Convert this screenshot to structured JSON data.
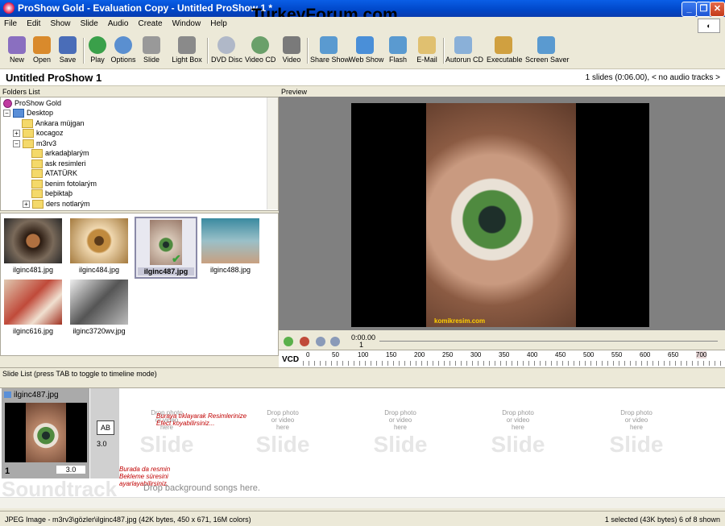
{
  "window": {
    "title": "ProShow Gold - Evaluation Copy - Untitled ProShow 1 *",
    "watermark": "TurkeyForum.com",
    "minimize_glyph": "_",
    "maximize_glyph": "❐",
    "close_glyph": "✕"
  },
  "menu": [
    "File",
    "Edit",
    "Show",
    "Slide",
    "Audio",
    "Create",
    "Window",
    "Help"
  ],
  "toolbar": [
    {
      "label": "New",
      "icon": "new-icon",
      "color": "#8a6fc0"
    },
    {
      "label": "Open",
      "icon": "open-icon",
      "color": "#d98a2c"
    },
    {
      "label": "Save",
      "icon": "save-icon",
      "color": "#4a6db8"
    },
    {
      "label": "Play",
      "icon": "play-icon",
      "color": "#3aa04a"
    },
    {
      "label": "Options",
      "icon": "options-icon",
      "color": "#5a8fd0"
    },
    {
      "label": "Slide",
      "icon": "slide-icon",
      "color": "#999"
    },
    {
      "label": "Light Box",
      "icon": "lightbox-icon",
      "color": "#8a8a8a"
    },
    {
      "label": "DVD Disc",
      "icon": "dvd-icon",
      "color": "#b0b8c8"
    },
    {
      "label": "Video CD",
      "icon": "vcd-icon",
      "color": "#6aa06a"
    },
    {
      "label": "Video",
      "icon": "video-icon",
      "color": "#7a7a7a"
    },
    {
      "label": "Share Show",
      "icon": "share-icon",
      "color": "#5a9ad0"
    },
    {
      "label": "Web Show",
      "icon": "web-icon",
      "color": "#4a8fd8"
    },
    {
      "label": "Flash",
      "icon": "flash-icon",
      "color": "#5a9ad0"
    },
    {
      "label": "E-Mail",
      "icon": "email-icon",
      "color": "#e0c070"
    },
    {
      "label": "Autorun CD",
      "icon": "autorun-icon",
      "color": "#8ab0d8"
    },
    {
      "label": "Executable",
      "icon": "executable-icon",
      "color": "#d0a040"
    },
    {
      "label": "Screen Saver",
      "icon": "screensaver-icon",
      "color": "#5a9ad0"
    }
  ],
  "project": {
    "name": "Untitled ProShow 1",
    "info": "1 slides (0:06.00), < no audio tracks >"
  },
  "folders": {
    "header": "Folders List",
    "items": [
      {
        "label": "ProShow Gold",
        "level": 0,
        "expander": "",
        "type": "app"
      },
      {
        "label": "Desktop",
        "level": 0,
        "expander": "−",
        "type": "desktop"
      },
      {
        "label": "Ankara müjgan",
        "level": 1,
        "expander": "",
        "type": "folder"
      },
      {
        "label": "kocagoz",
        "level": 1,
        "expander": "+",
        "type": "folder"
      },
      {
        "label": "m3rv3",
        "level": 1,
        "expander": "−",
        "type": "folder"
      },
      {
        "label": "arkadaþlarým",
        "level": 2,
        "expander": "",
        "type": "folder"
      },
      {
        "label": "ask resimleri",
        "level": 2,
        "expander": "",
        "type": "folder"
      },
      {
        "label": "ATATÜRK",
        "level": 2,
        "expander": "",
        "type": "folder"
      },
      {
        "label": "benim fotolarým",
        "level": 2,
        "expander": "",
        "type": "folder"
      },
      {
        "label": "beþiktaþ",
        "level": 2,
        "expander": "",
        "type": "folder"
      },
      {
        "label": "ders notlarým",
        "level": 2,
        "expander": "+",
        "type": "folder"
      }
    ]
  },
  "files": [
    {
      "name": "ilginc481.jpg",
      "color": "#5a4a3a"
    },
    {
      "name": "ilginc484.jpg",
      "color": "#a47a3e"
    },
    {
      "name": "ilginc487.jpg",
      "color": "#8a9a8a",
      "selected": true
    },
    {
      "name": "ilginc488.jpg",
      "color": "#4a8a9a"
    },
    {
      "name": "ilginc616.jpg",
      "color": "#c04a3a"
    },
    {
      "name": "ilginc3720wv.jpg",
      "color": "#6a6a6a"
    }
  ],
  "preview": {
    "header": "Preview",
    "caption": "komikresim.com",
    "time": "0:00.00",
    "slide_number": "1",
    "ruler_label": "VCD",
    "ruler_ticks": [
      "0",
      "50",
      "100",
      "150",
      "200",
      "250",
      "300",
      "350",
      "400",
      "450",
      "500",
      "550",
      "600",
      "650",
      "700"
    ]
  },
  "slides": {
    "header": "Slide List (press TAB to toggle to timeline mode)",
    "slide": {
      "name": "ilginc487.jpg",
      "number": "1",
      "duration": "3.0",
      "transition": "AB",
      "transition_duration": "3.0"
    },
    "empty_drop": "Drop photo\nor video\nhere",
    "empty_label": "Slide",
    "note_transition": "Buraya tıklayarak Resimlerinize\nEfect koyabilirsiniz...",
    "note_duration": "Burada da resmin\nBekleme süresini\nayarlayabilirsiniz.",
    "soundtrack": "Soundtrack",
    "soundtrack_hint": "Drop background songs here."
  },
  "status": {
    "left": "JPEG Image - m3rv3\\gözler\\ilginc487.jpg  (42K bytes, 450 x 671, 16M colors)",
    "right": "1 selected (43K bytes) 6 of 8 shown"
  }
}
